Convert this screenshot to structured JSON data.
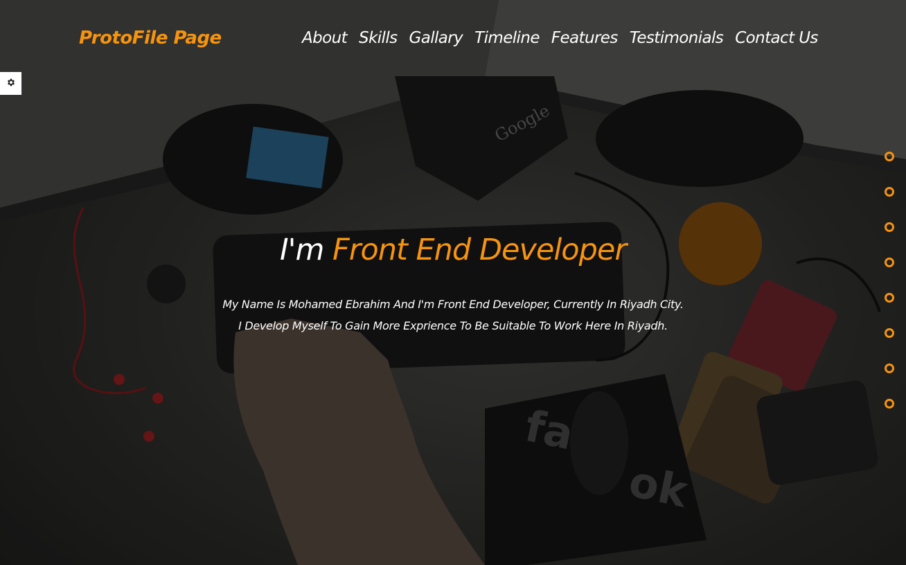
{
  "header": {
    "logo": "ProtoFile Page",
    "nav": [
      {
        "label": "About"
      },
      {
        "label": "Skills"
      },
      {
        "label": "Gallary"
      },
      {
        "label": "Timeline"
      },
      {
        "label": "Features"
      },
      {
        "label": "Testimonials"
      },
      {
        "label": "Contact Us"
      }
    ]
  },
  "settings": {
    "icon": "gear-icon"
  },
  "hero": {
    "title_prefix": "I'm",
    "title_accent": "Front End Developer",
    "line1": "My Name Is Mohamed Ebrahim And I'm Front End Developer, Currently In Riyadh City.",
    "line2": "I Develop Myself To Gain More Exprience To Be Suitable To Work Here In Riyadh."
  },
  "bullets": {
    "count": 8,
    "active_index": null
  },
  "colors": {
    "accent": "#f7940d",
    "text": "#ffffff",
    "settings_bg": "#ffffff"
  }
}
